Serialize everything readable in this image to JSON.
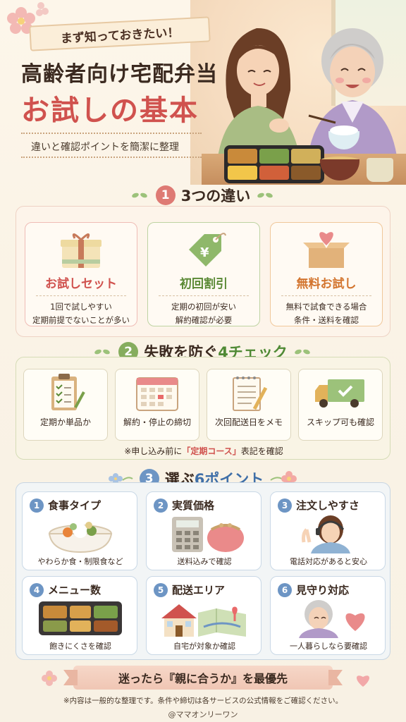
{
  "header": {
    "ribbon": "まず知っておきたい！",
    "title_line1": "高齢者向け宅配弁当",
    "title_line2": "お試しの基本",
    "subtitle": "違いと確認ポイントを簡潔に整理"
  },
  "section1": {
    "number": "1",
    "title": "3つの違い",
    "cards": [
      {
        "title": "お試しセット",
        "lines": [
          "1回で試しやすい",
          "定期前提でないことが多い"
        ],
        "icon": "gift-box-icon"
      },
      {
        "title": "初回割引",
        "lines": [
          "定期の初回が安い",
          "解約確認が必要"
        ],
        "icon": "price-tag-icon"
      },
      {
        "title": "無料お試し",
        "lines": [
          "無料で試食できる場合",
          "条件・送料を確認"
        ],
        "icon": "heart-box-icon"
      }
    ]
  },
  "section2": {
    "number": "2",
    "title_prefix": "失敗を防ぐ",
    "title_highlight": "4チェック",
    "cards": [
      {
        "label": "定期か単品か",
        "icon": "clipboard-checklist-icon"
      },
      {
        "label": "解約・停止の締切",
        "icon": "calendar-icon"
      },
      {
        "label": "次回配送日をメモ",
        "icon": "notepad-pencil-icon"
      },
      {
        "label": "スキップ可も確認",
        "icon": "delivery-truck-icon"
      }
    ],
    "note_prefix": "※申し込み前に",
    "note_quote": "「定期コース」",
    "note_suffix": "表記を確認"
  },
  "section3": {
    "number": "3",
    "title_prefix": "選ぶ",
    "title_highlight": "6ポイント",
    "cards": [
      {
        "num": "1",
        "title": "食事タイプ",
        "desc": "やわらか食・制限食など",
        "icon": "meal-bowl-icon"
      },
      {
        "num": "2",
        "title": "実質価格",
        "desc": "送料込みで確認",
        "icon": "calculator-purse-icon"
      },
      {
        "num": "3",
        "title": "注文しやすさ",
        "desc": "電話対応があると安心",
        "icon": "operator-headset-icon"
      },
      {
        "num": "4",
        "title": "メニュー数",
        "desc": "飽きにくさを確認",
        "icon": "bento-tray-icon"
      },
      {
        "num": "5",
        "title": "配送エリア",
        "desc": "自宅が対象か確認",
        "icon": "house-map-icon"
      },
      {
        "num": "6",
        "title": "見守り対応",
        "desc": "一人暮らしなら要確認",
        "icon": "elder-heart-icon"
      }
    ]
  },
  "footer": {
    "banner": "迷ったら『親に合うか』を最優先",
    "disclaimer": "※内容は一般的な整理です。条件や締切は各サービスの公式情報をご確認ください。",
    "credit": "@ママオンリーワン"
  },
  "colors": {
    "accent_red": "#d0524e",
    "accent_green": "#5b8a36",
    "accent_blue": "#6d95c4",
    "background": "#fbf5e9"
  }
}
